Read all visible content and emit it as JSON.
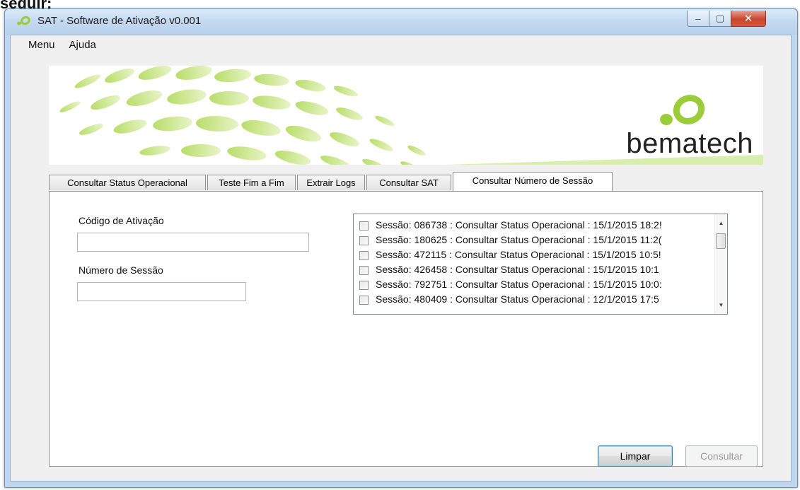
{
  "cutoff_text": "seguir:",
  "window": {
    "title": "SAT - Software de Ativação v0.001",
    "minimize_glyph": "–",
    "maximize_glyph": "▢",
    "close_glyph": "✕"
  },
  "menu": {
    "items": [
      {
        "label": "Menu"
      },
      {
        "label": "Ajuda"
      }
    ]
  },
  "banner": {
    "brand": "bematech",
    "accent_color": "#9bcc3a",
    "logo_icon": "bematech-logo-icon"
  },
  "tabs": [
    {
      "label": "Consultar Status Operacional",
      "active": false
    },
    {
      "label": "Teste Fim a Fim",
      "active": false
    },
    {
      "label": "Extrair Logs",
      "active": false
    },
    {
      "label": "Consultar SAT",
      "active": false
    },
    {
      "label": "Consultar Número de Sessão",
      "active": true
    }
  ],
  "form": {
    "activation_code_label": "Código de Ativação",
    "activation_code_value": "",
    "session_number_label": "Número de Sessão",
    "session_number_value": ""
  },
  "sessions": [
    {
      "text": "Sessão: 086738 : Consultar Status Operacional : 15/1/2015 18:2!",
      "checked": false
    },
    {
      "text": "Sessão: 180625 : Consultar Status Operacional : 15/1/2015 11:2(",
      "checked": false
    },
    {
      "text": "Sessão: 472115 : Consultar Status Operacional : 15/1/2015 10:5!",
      "checked": false
    },
    {
      "text": "Sessão: 426458 : Consultar Status Operacional : 15/1/2015 10:1",
      "checked": false
    },
    {
      "text": "Sessão: 792751 : Consultar Status Operacional : 15/1/2015 10:0:",
      "checked": false
    },
    {
      "text": "Sessão: 480409 : Consultar Status Operacional : 12/1/2015 17:5",
      "checked": false
    }
  ],
  "scrollbar": {
    "up_glyph": "▲",
    "down_glyph": "▼"
  },
  "buttons": {
    "clear_label": "Limpar",
    "query_label": "Consultar"
  }
}
